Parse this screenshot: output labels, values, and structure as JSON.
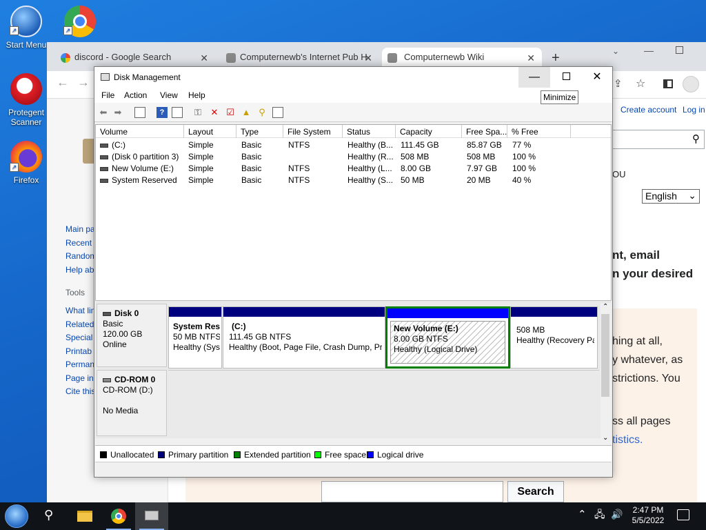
{
  "desktop": {
    "icons": [
      {
        "label": "Start Menu"
      },
      {
        "label": "Protegent Scanner"
      },
      {
        "label": "Firefox"
      }
    ]
  },
  "browser": {
    "tabs": [
      {
        "title": "discord - Google Search"
      },
      {
        "title": "Computernewb's Internet Pub H"
      },
      {
        "title": "Computernewb Wiki"
      }
    ],
    "new_tab": "+",
    "account": {
      "create": "Create account",
      "login": "Log in"
    },
    "language": "English",
    "sidebar_main": [
      "Main pa",
      "Recent",
      "Random",
      "Help ab"
    ],
    "sidebar_tools_heading": "Tools",
    "sidebar_tools": [
      "What lin",
      "Related",
      "Special",
      "Printab",
      "Perman",
      "Page in",
      "Cite this"
    ],
    "content": {
      "fragment_you": "OU",
      "line1": "nt, email",
      "line2": "n your desired",
      "para1": "hing at all,",
      "para2": "y whatever, as",
      "para3": "strictions. You",
      "para4": "ss all pages",
      "stats_link": "tistics."
    },
    "search_button": "Search"
  },
  "disk_management": {
    "title": "Disk Management",
    "menu": [
      "File",
      "Action",
      "View",
      "Help"
    ],
    "tooltip": "Minimize",
    "columns": [
      "Volume",
      "Layout",
      "Type",
      "File System",
      "Status",
      "Capacity",
      "Free Spa...",
      "% Free"
    ],
    "rows": [
      {
        "volume": "(C:)",
        "layout": "Simple",
        "type": "Basic",
        "fs": "NTFS",
        "status": "Healthy (B...",
        "capacity": "111.45 GB",
        "free": "85.87 GB",
        "pct": "77 %"
      },
      {
        "volume": "(Disk 0 partition 3)",
        "layout": "Simple",
        "type": "Basic",
        "fs": "",
        "status": "Healthy (R...",
        "capacity": "508 MB",
        "free": "508 MB",
        "pct": "100 %"
      },
      {
        "volume": "New Volume (E:)",
        "layout": "Simple",
        "type": "Basic",
        "fs": "NTFS",
        "status": "Healthy (L...",
        "capacity": "8.00 GB",
        "free": "7.97 GB",
        "pct": "100 %"
      },
      {
        "volume": "System Reserved",
        "layout": "Simple",
        "type": "Basic",
        "fs": "NTFS",
        "status": "Healthy (S...",
        "capacity": "50 MB",
        "free": "20 MB",
        "pct": "40 %"
      }
    ],
    "disk0": {
      "name": "Disk 0",
      "type": "Basic",
      "size": "120.00 GB",
      "state": "Online"
    },
    "partitions": [
      {
        "name": "System Res",
        "size": "50 MB NTFS",
        "status": "Healthy (Sys"
      },
      {
        "name": "(C:)",
        "size": "111.45 GB NTFS",
        "status": "Healthy (Boot, Page File, Crash Dump, Pri"
      },
      {
        "name": "New Volume  (E:)",
        "size": "8.00 GB NTFS",
        "status": "Healthy (Logical Drive)"
      },
      {
        "name": "",
        "size": "508 MB",
        "status": "Healthy (Recovery Pa"
      }
    ],
    "cdrom": {
      "name": "CD-ROM 0",
      "type": "CD-ROM (D:)",
      "media": "No Media"
    },
    "legend": [
      {
        "label": "Unallocated",
        "color": "#000000"
      },
      {
        "label": "Primary partition",
        "color": "#00007f"
      },
      {
        "label": "Extended partition",
        "color": "#007f00"
      },
      {
        "label": "Free space",
        "color": "#00ff00"
      },
      {
        "label": "Logical drive",
        "color": "#0000ff"
      }
    ]
  },
  "taskbar": {
    "time": "2:47 PM",
    "date": "5/5/2022"
  }
}
